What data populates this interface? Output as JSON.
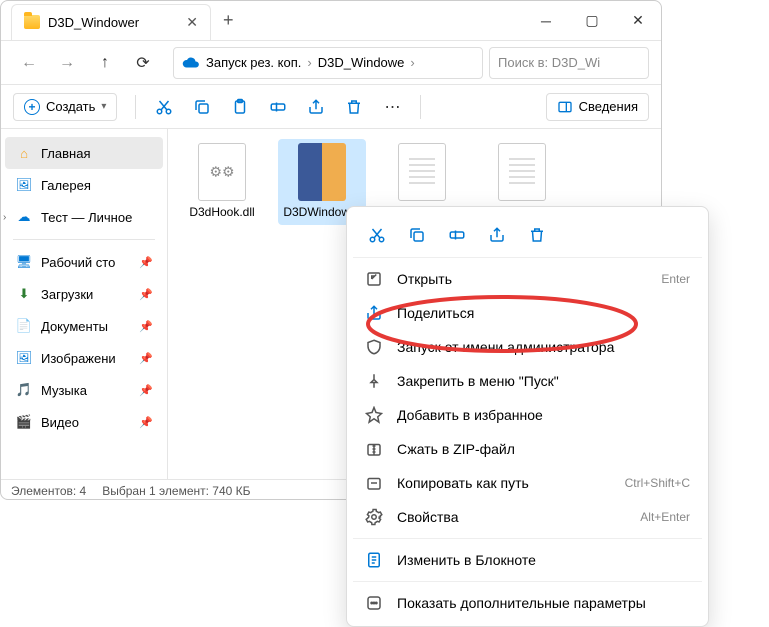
{
  "tab": {
    "title": "D3D_Windower"
  },
  "navbar": {
    "breadcrumb1": "Запуск рез. коп.",
    "breadcrumb2": "D3D_Windowe",
    "search_placeholder": "Поиск в: D3D_Wi"
  },
  "toolbar": {
    "create": "Создать",
    "details": "Сведения"
  },
  "sidebar": {
    "home": "Главная",
    "gallery": "Галерея",
    "personal": "Тест — Личное",
    "desktop": "Рабочий сто",
    "downloads": "Загрузки",
    "documents": "Документы",
    "pictures": "Изображени",
    "music": "Музыка",
    "videos": "Видео"
  },
  "files": [
    {
      "name": "D3dHook.dll"
    },
    {
      "name": "D3DWindower"
    }
  ],
  "statusbar": {
    "count": "Элементов: 4",
    "selection": "Выбран 1 элемент: 740 КБ"
  },
  "context_menu": {
    "open": "Открыть",
    "open_shortcut": "Enter",
    "share": "Поделиться",
    "run_admin": "Запуск от имени администратора",
    "pin_start": "Закрепить в меню \"Пуск\"",
    "favorite": "Добавить в избранное",
    "zip": "Сжать в ZIP-файл",
    "copy_path": "Копировать как путь",
    "copy_path_shortcut": "Ctrl+Shift+C",
    "properties": "Свойства",
    "properties_shortcut": "Alt+Enter",
    "edit_notepad": "Изменить в Блокноте",
    "more": "Показать дополнительные параметры"
  }
}
